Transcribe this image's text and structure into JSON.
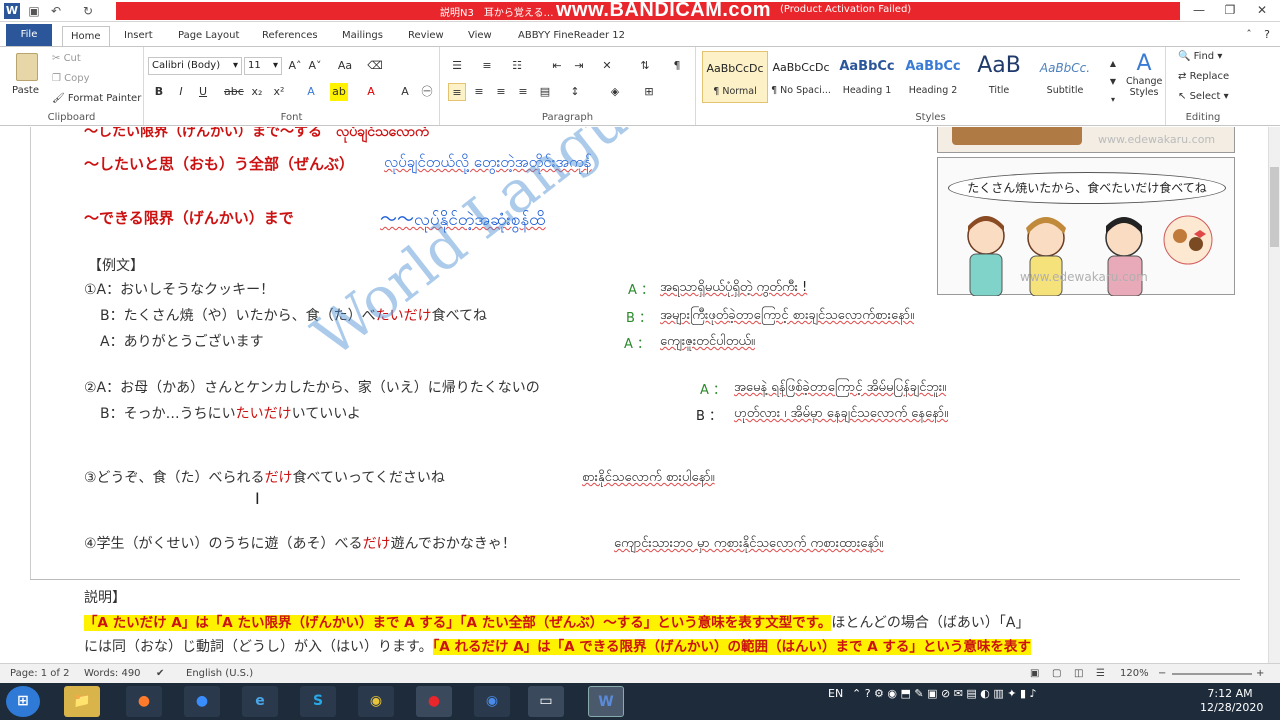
{
  "titlebar": {
    "doc_title": "説明N3　耳から覚える…",
    "recorder_watermark": "www.BANDICAM.com",
    "activation_note": "(Product Activation Failed)"
  },
  "tabs": [
    "File",
    "Home",
    "Insert",
    "Page Layout",
    "References",
    "Mailings",
    "Review",
    "View",
    "ABBYY FineReader 12"
  ],
  "clipboard": {
    "paste": "Paste",
    "cut": "Cut",
    "copy": "Copy",
    "format_painter": "Format Painter",
    "group": "Clipboard"
  },
  "font": {
    "name": "Calibri (Body)",
    "size": "11",
    "group": "Font"
  },
  "paragraph": {
    "group": "Paragraph"
  },
  "styles": {
    "group": "Styles",
    "items": [
      {
        "sample": "AaBbCcDc",
        "name": "¶ Normal"
      },
      {
        "sample": "AaBbCcDc",
        "name": "¶ No Spaci..."
      },
      {
        "sample": "AaBbCc",
        "name": "Heading 1"
      },
      {
        "sample": "AaBbCc",
        "name": "Heading 2"
      },
      {
        "sample": "AaB",
        "name": "Title"
      },
      {
        "sample": "AaBbCc.",
        "name": "Subtitle"
      }
    ],
    "change": "Change Styles"
  },
  "editing": {
    "find": "Find",
    "replace": "Replace",
    "select": "Select",
    "group": "Editing"
  },
  "doc": {
    "line0": "～したい限界（げんかい）まで～する　လုပ်ချင်သလောက်",
    "line1_jp": "～したいと思（おも）う全部（ぜんぶ）",
    "line1_my": "လုပ်ချင်တယ်လို့ တွေးတဲ့အတိုင်းအကုန်",
    "line2_jp": "～できる限界（げんかい）まで",
    "line2_my": "～～လုပ်နိုင်တဲ့အဆုံးစွန်ထိ",
    "example_header": "【例文】",
    "e1a": "①A：おいしそうなクッキー！",
    "e1a_label": "A ：",
    "e1a_my": "အရသာရှိမယ်ပုံရှိတဲ့ ကွတ်ကီး !",
    "e1b_pre": "B：たくさん焼（や）いたから、食（た）べ",
    "e1b_red": "たいだけ",
    "e1b_post": "食べてね",
    "e1b_label": "B ：",
    "e1b_my": "အများကြီးဖုတ်ခဲ့တာကြောင့် စားချင်သလောက်စားနော်။",
    "e1c": "A：ありがとうございます",
    "e1c_label": "A ：",
    "e1c_my": "ကျေးဇူးတင်ပါတယ်။",
    "e2a": "②A：お母（かあ）さんとケンカしたから、家（いえ）に帰りたくないの",
    "e2a_label": "A ：",
    "e2a_my": "အမေနဲ့ ရန်ဖြစ်ခဲ့တာကြောင့် အိမ်မပြန်ချင်ဘူး။",
    "e2b_pre": "B：そっか…うちにい",
    "e2b_red": "たいだけ",
    "e2b_post": "いていいよ",
    "e2b_label": "B ：",
    "e2b_my": "ဟုတ်လား ၊ အိမ်မှာ နေချင်သလောက် နေနော်။",
    "e3_pre": "③どうぞ、食（た）べられる",
    "e3_red": "だけ",
    "e3_post": "食べていってくださいね",
    "e3_my": "စားနိုင်သလောက် စားပါနော်။",
    "e4_pre": "④学生（がくせい）のうちに遊（あそ）べる",
    "e4_red": "だけ",
    "e4_post": "遊んでおかなきゃ！",
    "e4_my": "ကျောင်းသားဘဝ မှာ ကစားနိုင်သလောက် ကစားထားနော်။",
    "explain_header": "説明】",
    "explain_hl": "「A たいだけ A」は「A たい限界（げんかい）まで A する」「A たい全部（ぜんぶ）～する」という意味を表す文型です。",
    "explain_rest": "ほとんどの場合（ばあい）「A」",
    "explain_line2_pre": "には同（おな）じ動詞（どうし）が入（はい）ります。",
    "explain_line2_hl": "「A れるだけ A」は「A できる限界（げんかい）の範囲（はんい）まで A する」という意味を表す",
    "image_bubble": "たくさん焼いたから、食べたいだけ食べてね",
    "image_site": "www.edewakaru.com",
    "doc_watermark": "World Language"
  },
  "status": {
    "page": "Page: 1 of 2",
    "words": "Words: 490",
    "language": "English (U.S.)",
    "zoom": "120%"
  },
  "taskbar": {
    "lang": "EN",
    "time": "7:12 AM",
    "date": "12/28/2020"
  },
  "colors": {
    "ribbon_blue": "#2b579a",
    "title_red": "#e8262b",
    "highlight": "#fff200",
    "accent_red": "#cc1111",
    "accent_blue": "#1a5bd6"
  }
}
